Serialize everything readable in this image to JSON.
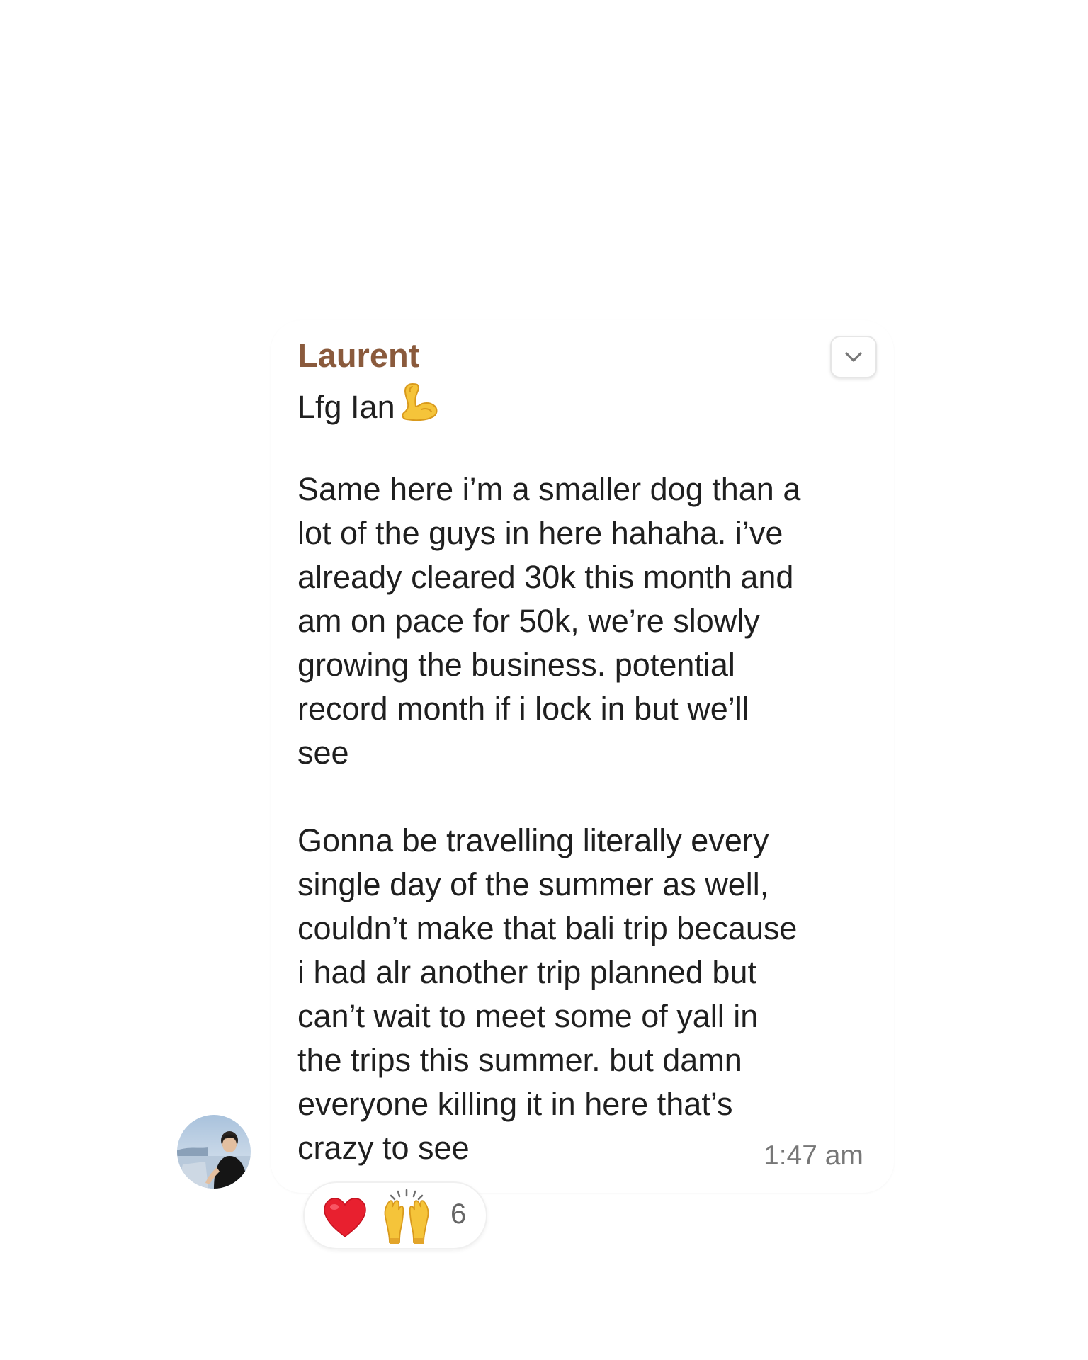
{
  "message": {
    "sender": "Laurent",
    "lines": [
      "Lfg Ian",
      "",
      "Same here i’m a smaller dog than a",
      "lot of the guys in here hahaha. i’ve",
      "already cleared 30k this month and",
      "am on pace for 50k, we’re slowly",
      "growing the business. potential",
      "record month if i lock in but we’ll",
      "see",
      "",
      "Gonna be travelling literally every",
      "single day of the summer as well,",
      "couldn’t make that bali trip because",
      "i had alr another trip planned but",
      "can’t wait to meet some of yall in",
      "the trips this summer. but damn",
      "everyone killing it in here that’s",
      "crazy to see"
    ],
    "timestamp": "1:47 am"
  },
  "reactions": {
    "emojis": [
      "heart-icon",
      "raised-hands-icon"
    ],
    "count": "6"
  },
  "colors": {
    "sender_name": "#8a5a3c",
    "timestamp": "#777777",
    "text": "#1f1f1f"
  }
}
